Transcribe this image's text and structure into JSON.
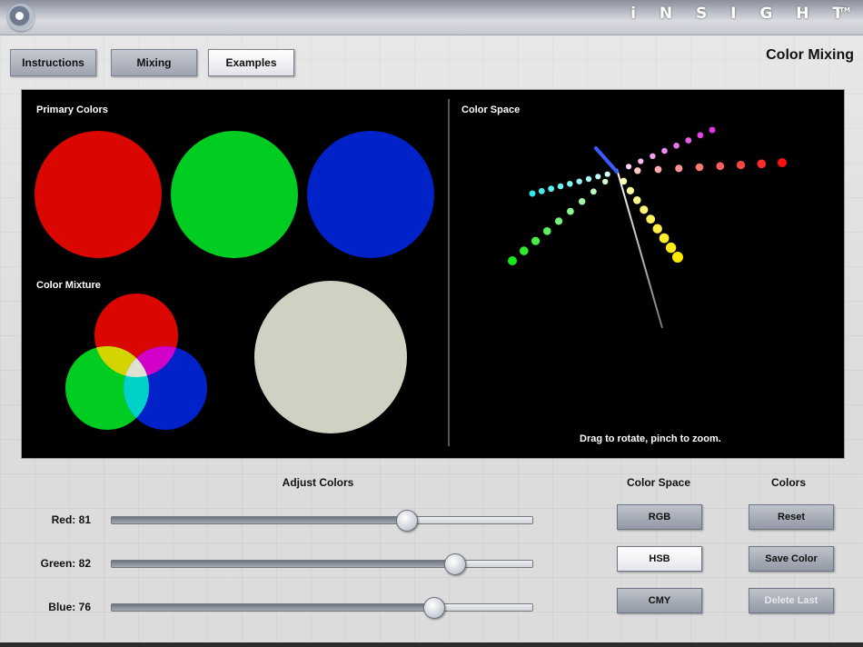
{
  "header": {
    "brand": "i N S I G H T",
    "tm": "TM",
    "logo_icon": "eye-icon"
  },
  "nav": {
    "buttons": [
      "Instructions",
      "Mixing",
      "Examples"
    ],
    "active": "Examples"
  },
  "page_title": "Color Mixing",
  "stage": {
    "primary_label": "Primary Colors",
    "mixture_label": "Color Mixture",
    "space_label": "Color Space",
    "hint": "Drag to rotate, pinch to zoom.",
    "colors": {
      "red": "#d90700",
      "green": "#00cc22",
      "blue": "#0022c8",
      "mixed": "#d1d1c3"
    }
  },
  "controls": {
    "adjust_title": "Adjust Colors",
    "sliders": [
      {
        "name": "Red",
        "text": "Red:",
        "value": "81",
        "level": 0.7
      },
      {
        "name": "Green",
        "text": "Green:",
        "value": "82",
        "level": 0.815
      },
      {
        "name": "Blue",
        "text": "Blue:",
        "value": "76",
        "level": 0.765
      }
    ],
    "color_space_title": "Color Space",
    "color_space_buttons": [
      "RGB",
      "HSB",
      "CMY"
    ],
    "color_space_selected": "HSB",
    "colors_title": "Colors",
    "colors_buttons": [
      "Reset",
      "Save Color",
      "Delete Last"
    ],
    "disabled": "Delete Last"
  }
}
